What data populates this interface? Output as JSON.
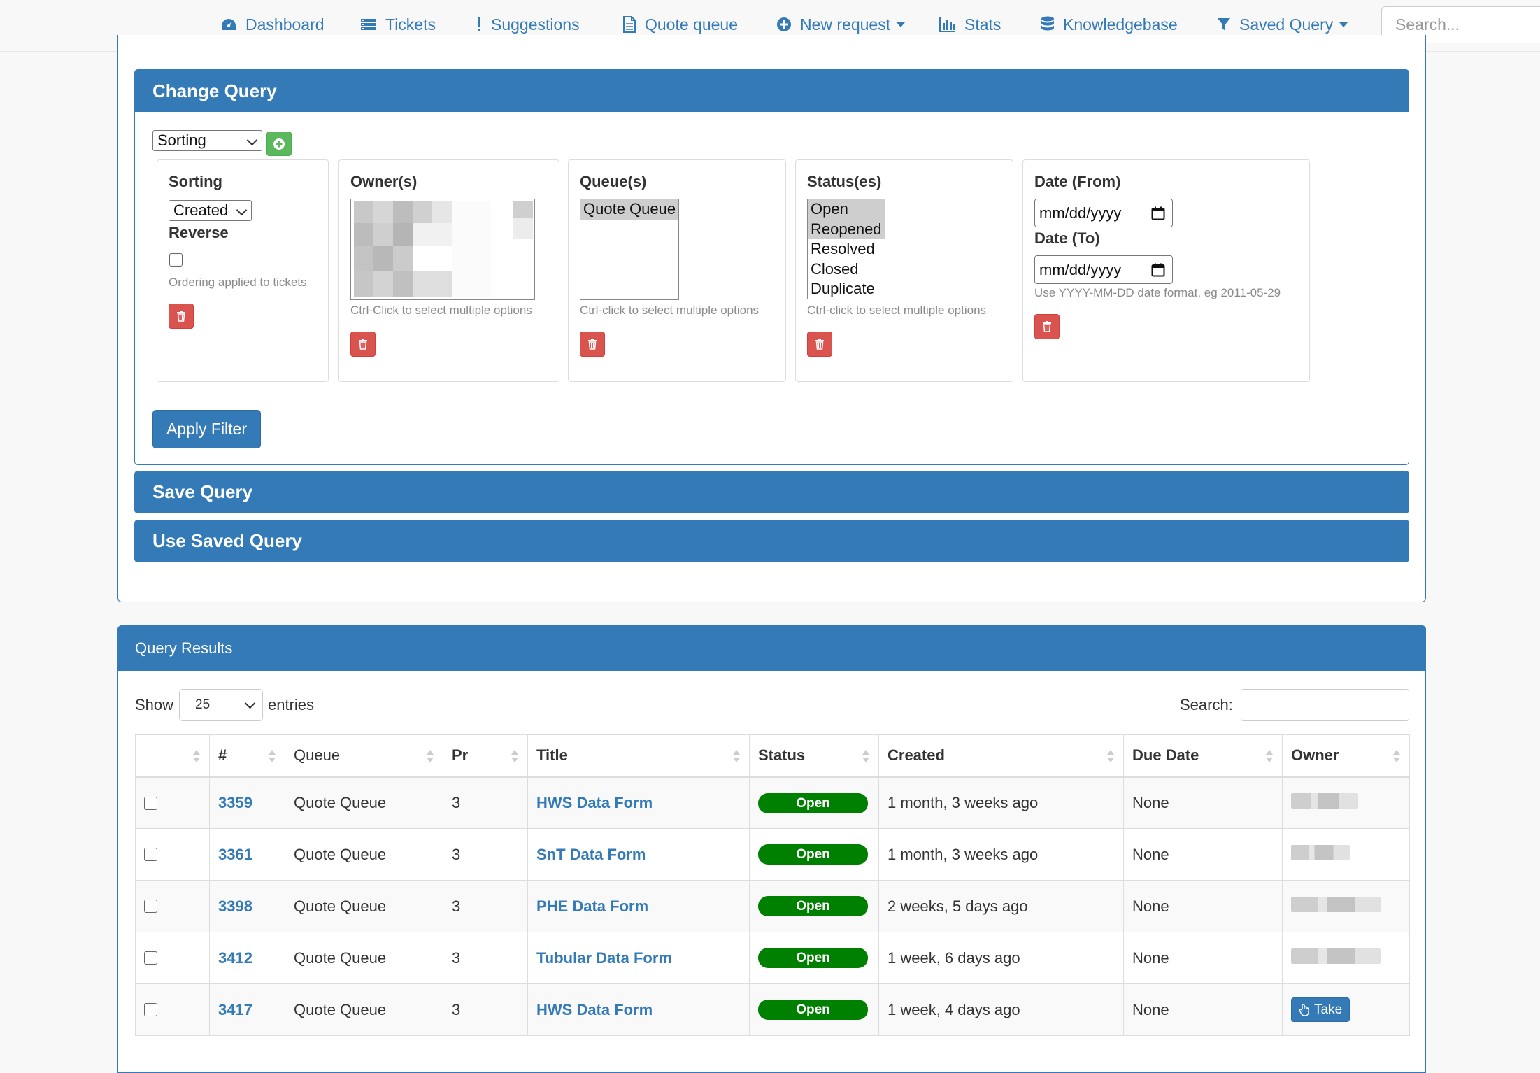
{
  "nav": {
    "items": [
      {
        "label": "Dashboard",
        "icon": "dashboard-icon"
      },
      {
        "label": "Tickets",
        "icon": "tickets-icon"
      },
      {
        "label": "Suggestions",
        "icon": "exclamation-icon"
      },
      {
        "label": "Quote queue",
        "icon": "document-icon"
      },
      {
        "label": "New request",
        "icon": "plus-circle-icon"
      },
      {
        "label": "Stats",
        "icon": "stats-icon"
      },
      {
        "label": "Knowledgebase",
        "icon": "database-icon"
      },
      {
        "label": "Saved Query",
        "icon": "filter-icon"
      }
    ],
    "search_placeholder": "Search..."
  },
  "change_query": {
    "title": "Change Query",
    "field_select": "Sorting",
    "sorting": {
      "label": "Sorting",
      "value": "Created",
      "reverse_label": "Reverse",
      "help": "Ordering applied to tickets"
    },
    "owners": {
      "label": "Owner(s)",
      "help": "Ctrl-Click to select multiple options"
    },
    "queues": {
      "label": "Queue(s)",
      "options": [
        "Quote Queue"
      ],
      "help": "Ctrl-click to select multiple options"
    },
    "statuses": {
      "label": "Status(es)",
      "options": [
        "Open",
        "Reopened",
        "Resolved",
        "Closed",
        "Duplicate"
      ],
      "help": "Ctrl-click to select multiple options"
    },
    "dates": {
      "from_label": "Date (From)",
      "to_label": "Date (To)",
      "from_value": "mm/dd/yyyy",
      "to_value": "mm/dd/yyyy",
      "help": "Use YYYY-MM-DD date format, eg 2011-05-29"
    },
    "apply_label": "Apply Filter"
  },
  "save_query": {
    "title": "Save Query"
  },
  "use_saved_query": {
    "title": "Use Saved Query"
  },
  "results": {
    "title": "Query Results",
    "show_label": "Show",
    "entries_value": "25",
    "entries_label": "entries",
    "search_label": "Search:",
    "columns": [
      "",
      "#",
      "Queue",
      "Pr",
      "Title",
      "Status",
      "Created",
      "Due Date",
      "Owner"
    ],
    "rows": [
      {
        "id": "3359",
        "queue": "Quote Queue",
        "pr": "3",
        "title": "HWS Data Form",
        "status": "Open",
        "created": "1 month, 3 weeks ago",
        "due": "None"
      },
      {
        "id": "3361",
        "queue": "Quote Queue",
        "pr": "3",
        "title": "SnT Data Form",
        "status": "Open",
        "created": "1 month, 3 weeks ago",
        "due": "None"
      },
      {
        "id": "3398",
        "queue": "Quote Queue",
        "pr": "3",
        "title": "PHE Data Form",
        "status": "Open",
        "created": "2 weeks, 5 days ago",
        "due": "None"
      },
      {
        "id": "3412",
        "queue": "Quote Queue",
        "pr": "3",
        "title": "Tubular Data Form",
        "status": "Open",
        "created": "1 week, 6 days ago",
        "due": "None"
      },
      {
        "id": "3417",
        "queue": "Quote Queue",
        "pr": "3",
        "title": "HWS Data Form",
        "status": "Open",
        "created": "1 week, 4 days ago",
        "due": "None"
      }
    ],
    "take_label": "Take"
  },
  "colors": {
    "primary": "#337ab7",
    "success": "#5cb85c",
    "danger": "#d9534f",
    "open_badge": "#008000"
  }
}
